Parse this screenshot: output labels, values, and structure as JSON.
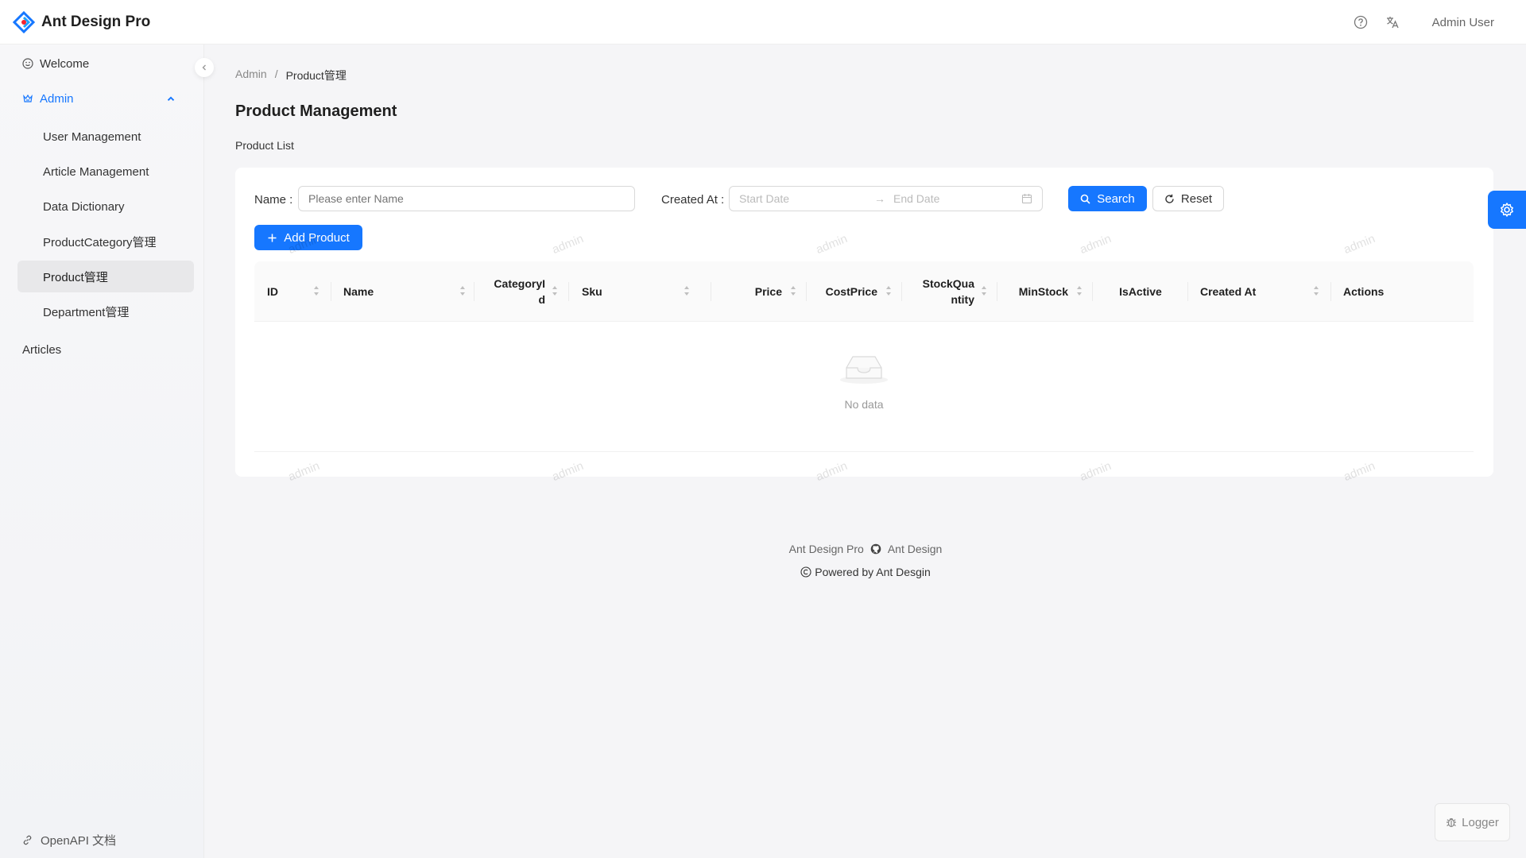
{
  "app": {
    "title": "Ant Design Pro"
  },
  "header": {
    "user_name": "Admin User"
  },
  "sidebar": {
    "items": [
      {
        "label": "Welcome"
      },
      {
        "label": "Admin"
      },
      {
        "label": "User Management"
      },
      {
        "label": "Article Management"
      },
      {
        "label": "Data Dictionary"
      },
      {
        "label": "ProductCategory管理"
      },
      {
        "label": "Product管理"
      },
      {
        "label": "Department管理"
      },
      {
        "label": "Articles"
      }
    ],
    "bottom_link": "OpenAPI 文档"
  },
  "breadcrumb": {
    "root": "Admin",
    "sep": "/",
    "current": "Product管理"
  },
  "page": {
    "title": "Product Management",
    "subtitle": "Product List"
  },
  "search": {
    "name_label": "Name :",
    "name_placeholder": "Please enter Name",
    "created_label": "Created At :",
    "start_placeholder": "Start Date",
    "end_placeholder": "End Date",
    "search_label": "Search",
    "reset_label": "Reset"
  },
  "toolbar": {
    "add_label": "Add Product"
  },
  "table": {
    "columns": [
      {
        "label": "ID"
      },
      {
        "label": "Name"
      },
      {
        "label": "CategoryId"
      },
      {
        "label": "Sku"
      },
      {
        "label": "Price"
      },
      {
        "label": "CostPrice"
      },
      {
        "label": "StockQuantity"
      },
      {
        "label": "MinStock"
      },
      {
        "label": "IsActive"
      },
      {
        "label": "Created At"
      },
      {
        "label": "Actions"
      }
    ],
    "empty_text": "No data"
  },
  "watermark": "admin",
  "footer": {
    "link1": "Ant Design Pro",
    "link2": "Ant Design",
    "copyright": "Powered by Ant Desgin"
  },
  "logger": {
    "label": "Logger"
  },
  "colors": {
    "primary": "#1677ff"
  }
}
